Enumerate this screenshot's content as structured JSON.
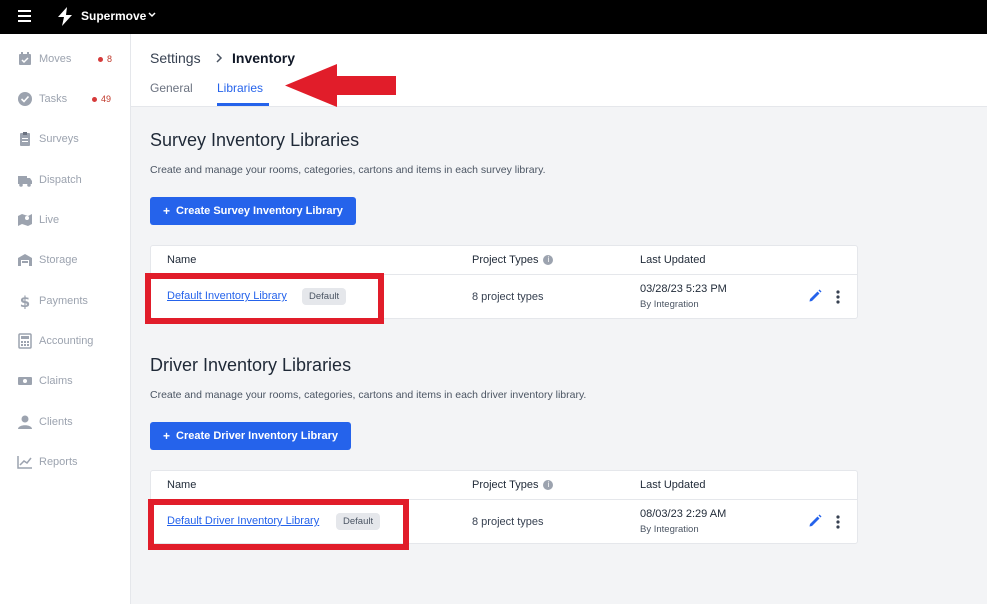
{
  "topbar": {
    "brand": "Supermove"
  },
  "sidebar": {
    "items": [
      {
        "label": "Moves",
        "badge": "8",
        "icon": "calendar-check-icon"
      },
      {
        "label": "Tasks",
        "badge": "49",
        "icon": "check-circle-icon"
      },
      {
        "label": "Surveys",
        "icon": "clipboard-icon"
      },
      {
        "label": "Dispatch",
        "icon": "truck-icon"
      },
      {
        "label": "Live",
        "icon": "map-icon"
      },
      {
        "label": "Storage",
        "icon": "warehouse-icon"
      },
      {
        "label": "Payments",
        "icon": "dollar-icon"
      },
      {
        "label": "Accounting",
        "icon": "calculator-icon"
      },
      {
        "label": "Claims",
        "icon": "money-bill-icon"
      },
      {
        "label": "Clients",
        "icon": "user-icon"
      },
      {
        "label": "Reports",
        "icon": "chart-line-icon"
      }
    ]
  },
  "breadcrumb": {
    "parent": "Settings",
    "current": "Inventory"
  },
  "tabs": {
    "general": "General",
    "libraries": "Libraries"
  },
  "survey": {
    "title": "Survey Inventory Libraries",
    "description": "Create and manage your rooms, categories, cartons and items in each survey library.",
    "button_label": "Create Survey Inventory Library",
    "columns": {
      "name": "Name",
      "project_types": "Project Types",
      "last_updated": "Last Updated"
    },
    "row": {
      "name": "Default Inventory Library",
      "badge": "Default",
      "project_types": "8 project types",
      "date": "03/28/23 5:23 PM",
      "by": "By Integration"
    }
  },
  "driver": {
    "title": "Driver Inventory Libraries",
    "description": "Create and manage your rooms, categories, cartons and items in each driver inventory library.",
    "button_label": "Create Driver Inventory Library",
    "columns": {
      "name": "Name",
      "project_types": "Project Types",
      "last_updated": "Last Updated"
    },
    "row": {
      "name": "Default Driver Inventory Library",
      "badge": "Default",
      "project_types": "8 project types",
      "date": "08/03/23 2:29 AM",
      "by": "By Integration"
    }
  },
  "colors": {
    "accent": "#2563eb",
    "annotation": "#e11d2a",
    "badge_dot": "#d63a3a"
  }
}
